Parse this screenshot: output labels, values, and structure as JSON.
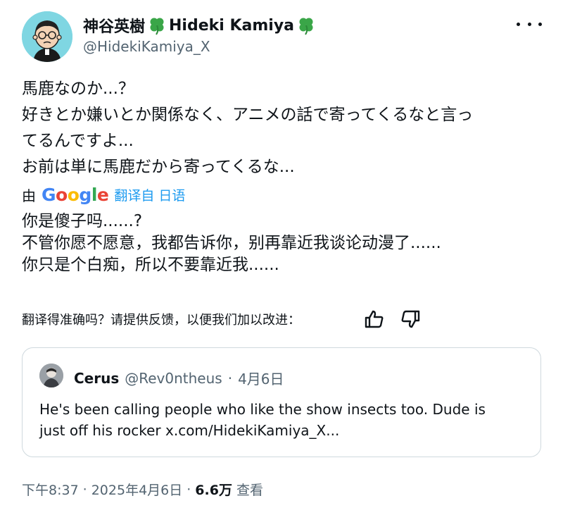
{
  "author": {
    "display_name": "神谷英樹",
    "display_name_en": "Hideki Kamiya",
    "handle": "@HidekiKamiya_X",
    "clover_icon": "four-leaf-clover-icon"
  },
  "tweet": {
    "lines": [
      "馬鹿なのか...？",
      "好きとか嫌いとか関係なく、アニメの話で寄ってくるなと言っ",
      "てるんですよ...",
      "お前は単に馬鹿だから寄ってくるな..."
    ]
  },
  "translation": {
    "by_label": "由",
    "provider": "Google",
    "from_label": "翻译自 日语",
    "lines": [
      "你是傻子吗......?",
      "不管你愿不愿意，我都告诉你，别再靠近我谈论动漫了......",
      "你只是个白痴，所以不要靠近我......"
    ],
    "feedback_prompt": "翻译得准确吗？请提供反馈，以便我们加以改进："
  },
  "quote": {
    "name": "Cerus",
    "handle": "@Rev0ntheus",
    "separator": "·",
    "date": "4月6日",
    "lines": [
      "He's been calling people who like the show insects too. Dude is",
      "just off his rocker x.com/HidekiKamiya_X..."
    ]
  },
  "meta": {
    "time": "下午8:37",
    "separator": "·",
    "date": "2025年4月6日",
    "views_count": "6.6万",
    "views_label": "查看"
  },
  "colors": {
    "link_blue": "#1d9bf0",
    "secondary_text": "#536471",
    "avatar_bg": "#7fd6e2",
    "clover_green": "#3aa648"
  }
}
